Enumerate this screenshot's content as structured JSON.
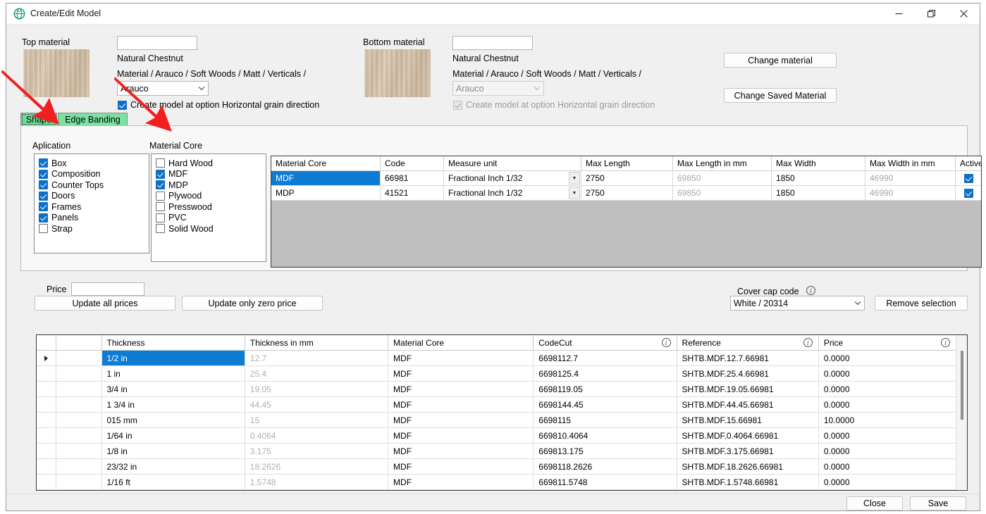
{
  "window": {
    "title": "Create/Edit Model",
    "icon": "globe-icon",
    "minimize": "–",
    "maximize": "❐",
    "close": "✕"
  },
  "top_material": {
    "label": "Top material",
    "name_value": "",
    "name_placeholder": "",
    "material_name": "Natural Chestnut",
    "path": "Material  / Arauco / Soft Woods / Matt / Verticals /",
    "brand_combo": "Arauco",
    "grain_checkbox_label": "Create model at option Horizontal grain direction",
    "grain_checked": true
  },
  "bottom_material": {
    "label": "Bottom material",
    "name_value": "",
    "material_name": "Natural Chestnut",
    "path": "Material  / Arauco / Soft Woods / Matt / Verticals /",
    "brand_combo": "Arauco",
    "grain_checkbox_label": "Create model at option Horizontal grain direction",
    "grain_checked": true
  },
  "actions": {
    "change_material": "Change material",
    "change_saved_material": "Change Saved Material"
  },
  "tabs": [
    {
      "label": "Shape",
      "selected": true
    },
    {
      "label": "Edge Banding",
      "selected": false
    }
  ],
  "aplication": {
    "title": "Aplication",
    "items": [
      {
        "label": "Box",
        "checked": true
      },
      {
        "label": "Composition",
        "checked": true
      },
      {
        "label": "Counter Tops",
        "checked": true
      },
      {
        "label": "Doors",
        "checked": true
      },
      {
        "label": "Frames",
        "checked": true
      },
      {
        "label": "Panels",
        "checked": true
      },
      {
        "label": "Strap",
        "checked": false
      }
    ]
  },
  "material_core": {
    "title": "Material Core",
    "items": [
      {
        "label": "Hard Wood",
        "checked": false
      },
      {
        "label": "MDF",
        "checked": true
      },
      {
        "label": "MDP",
        "checked": true
      },
      {
        "label": "Plywood",
        "checked": false
      },
      {
        "label": "Presswood",
        "checked": false
      },
      {
        "label": "PVC",
        "checked": false
      },
      {
        "label": "Solid Wood",
        "checked": false
      }
    ]
  },
  "core_grid": {
    "columns": [
      "Material Core",
      "Code",
      "Measure unit",
      "Max Length",
      "Max Length in mm",
      "Max Width",
      "Max Width in mm",
      "Active"
    ],
    "rows": [
      {
        "material_core": "MDF",
        "code": "66981",
        "measure_unit": "Fractional Inch 1/32",
        "max_length": "2750",
        "max_length_mm": "69850",
        "max_width": "1850",
        "max_width_mm": "46990",
        "active": true,
        "selected": true
      },
      {
        "material_core": "MDP",
        "code": "41521",
        "measure_unit": "Fractional Inch 1/32",
        "max_length": "2750",
        "max_length_mm": "69850",
        "max_width": "1850",
        "max_width_mm": "46990",
        "active": true,
        "selected": false
      }
    ]
  },
  "price_section": {
    "price_label": "Price",
    "price_value": "",
    "update_all": "Update all prices",
    "update_zero": "Update only zero price"
  },
  "cover_cap": {
    "label": "Cover cap code",
    "info_icon": "info-icon",
    "selected": "White / 20314",
    "remove_button": "Remove selection"
  },
  "thickness_grid": {
    "columns": [
      {
        "label": "Thickness",
        "info": false
      },
      {
        "label": "Thickness in mm",
        "info": false
      },
      {
        "label": "Material Core",
        "info": false
      },
      {
        "label": "CodeCut",
        "info": true
      },
      {
        "label": "Reference",
        "info": true
      },
      {
        "label": "Price",
        "info": true
      }
    ],
    "rows": [
      {
        "marker": true,
        "thickness": "1/2 in",
        "thickness_mm": "12.7",
        "material_core": "MDF",
        "codecut": "6698112.7",
        "reference": "SHTB.MDF.12.7.66981",
        "price": "0.0000",
        "selected": true
      },
      {
        "marker": false,
        "thickness": "1 in",
        "thickness_mm": "25.4",
        "material_core": "MDF",
        "codecut": "6698125.4",
        "reference": "SHTB.MDF.25.4.66981",
        "price": "0.0000",
        "selected": false
      },
      {
        "marker": false,
        "thickness": "3/4 in",
        "thickness_mm": "19.05",
        "material_core": "MDF",
        "codecut": "6698119.05",
        "reference": "SHTB.MDF.19.05.66981",
        "price": "0.0000",
        "selected": false
      },
      {
        "marker": false,
        "thickness": "1 3/4 in",
        "thickness_mm": "44.45",
        "material_core": "MDF",
        "codecut": "6698144.45",
        "reference": "SHTB.MDF.44.45.66981",
        "price": "0.0000",
        "selected": false
      },
      {
        "marker": false,
        "thickness": "015 mm",
        "thickness_mm": "15",
        "material_core": "MDF",
        "codecut": "6698115",
        "reference": "SHTB.MDF.15.66981",
        "price": "10.0000",
        "selected": false
      },
      {
        "marker": false,
        "thickness": "1/64 in",
        "thickness_mm": "0.4064",
        "material_core": "MDF",
        "codecut": "669810.4064",
        "reference": "SHTB.MDF.0.4064.66981",
        "price": "0.0000",
        "selected": false
      },
      {
        "marker": false,
        "thickness": "1/8 in",
        "thickness_mm": "3.175",
        "material_core": "MDF",
        "codecut": "669813.175",
        "reference": "SHTB.MDF.3.175.66981",
        "price": "0.0000",
        "selected": false
      },
      {
        "marker": false,
        "thickness": "23/32 in",
        "thickness_mm": "18.2626",
        "material_core": "MDF",
        "codecut": "6698118.2626",
        "reference": "SHTB.MDF.18.2626.66981",
        "price": "0.0000",
        "selected": false
      },
      {
        "marker": false,
        "thickness": "1/16 ft",
        "thickness_mm": "1.5748",
        "material_core": "MDF",
        "codecut": "669811.5748",
        "reference": "SHTB.MDF.1.5748.66981",
        "price": "0.0000",
        "selected": false
      }
    ]
  },
  "footer": {
    "close": "Close",
    "save": "Save"
  },
  "colors": {
    "selection_blue": "#0f7cd4",
    "checkbox_blue": "#0f6fc6",
    "tab_green": "#7ae1a0",
    "annotation_red": "#f02020",
    "window_bg": "#f0f0f0"
  }
}
